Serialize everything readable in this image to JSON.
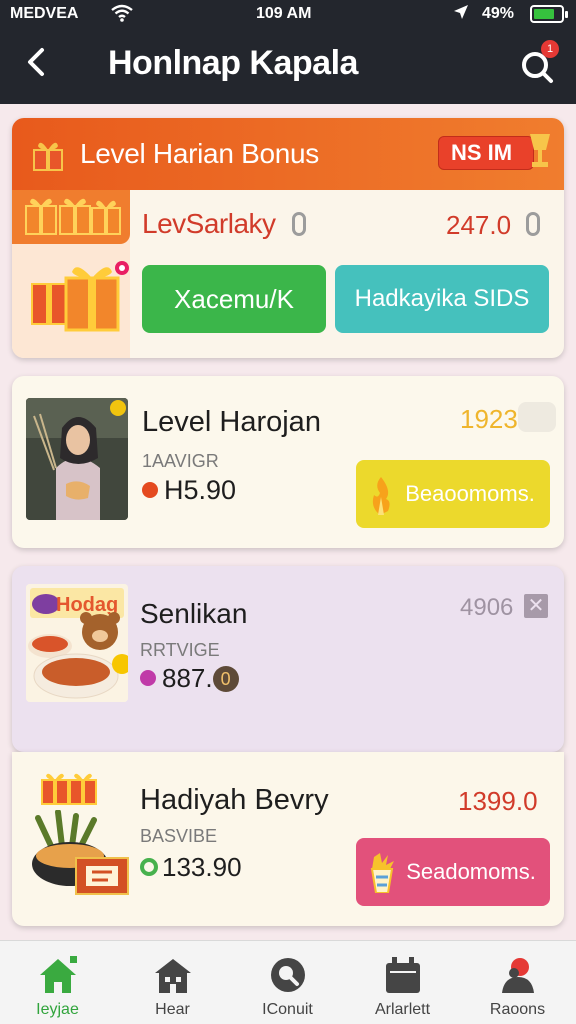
{
  "status_bar": {
    "carrier": "MEDVEA",
    "time": "109 AM",
    "battery": "49%",
    "battery_level": 0.75
  },
  "header": {
    "title": "Honlnap Kapala",
    "notification_count": "1"
  },
  "cards": [
    {
      "banner_title": "Level Harian Bonus",
      "banner_badge": "NS IM",
      "row_title": "LevSarlaky",
      "row_value": "247.0",
      "button_primary": "Xacemu/K",
      "button_secondary": "Hadkayika SIDS"
    },
    {
      "title": "Level Harojan",
      "subtitle": "1AAVIGR",
      "price": "H5.90",
      "value": "1923",
      "button_label": "Beaoomoms."
    },
    {
      "title": "Senlikan",
      "subtitle": "RRTVIGE",
      "price": "887.",
      "price_badge": "0",
      "value": "4906",
      "thumb_label": "Hodag"
    },
    {
      "title": "Hadiyah Bevry",
      "subtitle": "BASVIBE",
      "price": "133.90",
      "value": "1399.0",
      "button_label": "Seadomoms."
    }
  ],
  "bottom_nav": [
    {
      "label": "Ieyjae",
      "icon": "home-icon",
      "active": true
    },
    {
      "label": "Hear",
      "icon": "building-icon",
      "active": false
    },
    {
      "label": "IConuit",
      "icon": "search-icon",
      "active": false
    },
    {
      "label": "Arlarlett",
      "icon": "calendar-icon",
      "active": false
    },
    {
      "label": "Raoons",
      "icon": "profile-icon",
      "active": false
    }
  ],
  "colors": {
    "header_bg": "#23262d",
    "accent_orange": "#e85a1c",
    "accent_green": "#3bb64a",
    "accent_teal": "#45c1bd",
    "accent_yellow": "#ecd92c",
    "accent_pink": "#e2517b",
    "price_red": "#d13b2a"
  }
}
